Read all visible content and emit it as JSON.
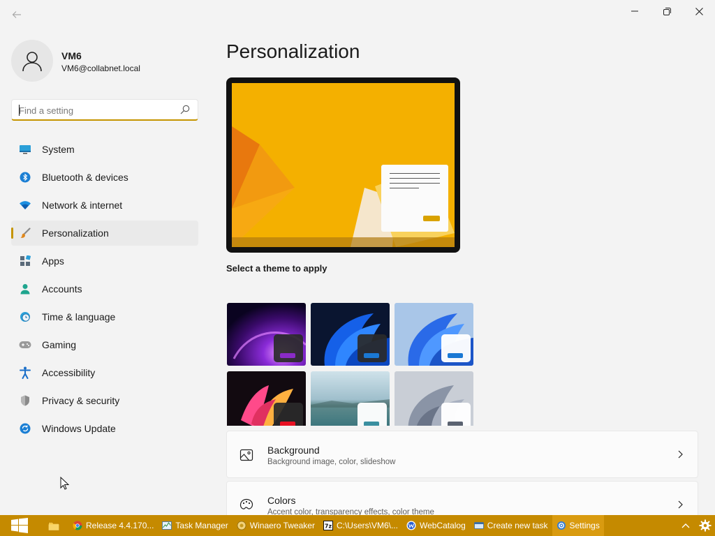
{
  "window": {
    "back_icon": "back-arrow-icon",
    "controls": [
      "minimize-icon",
      "restore-icon",
      "close-icon"
    ]
  },
  "profile": {
    "name": "VM6",
    "email": "VM6@collabnet.local"
  },
  "search": {
    "placeholder": "Find a setting",
    "value": ""
  },
  "nav": {
    "items": [
      {
        "label": "System",
        "icon": "monitor-icon"
      },
      {
        "label": "Bluetooth & devices",
        "icon": "bluetooth-icon"
      },
      {
        "label": "Network & internet",
        "icon": "wifi-icon"
      },
      {
        "label": "Personalization",
        "icon": "brush-icon",
        "active": true
      },
      {
        "label": "Apps",
        "icon": "apps-icon"
      },
      {
        "label": "Accounts",
        "icon": "person-icon"
      },
      {
        "label": "Time & language",
        "icon": "clock-globe-icon"
      },
      {
        "label": "Gaming",
        "icon": "gamepad-icon"
      },
      {
        "label": "Accessibility",
        "icon": "accessibility-icon"
      },
      {
        "label": "Privacy & security",
        "icon": "shield-icon"
      },
      {
        "label": "Windows Update",
        "icon": "update-icon"
      }
    ]
  },
  "main": {
    "title": "Personalization",
    "theme_label": "Select a theme to apply",
    "themes": [
      {
        "name": "dark-purple-glow"
      },
      {
        "name": "windows-dark-bloom"
      },
      {
        "name": "windows-light-bloom"
      },
      {
        "name": "captured-motion"
      },
      {
        "name": "glow-lake"
      },
      {
        "name": "sunrise-flow"
      }
    ],
    "cards": [
      {
        "title": "Background",
        "subtitle": "Background image, color, slideshow",
        "icon": "image-icon"
      },
      {
        "title": "Colors",
        "subtitle": "Accent color, transparency effects, color theme",
        "icon": "palette-icon"
      }
    ]
  },
  "taskbar": {
    "accent": "#c58a00",
    "items": [
      {
        "label": "",
        "icon": "file-explorer-icon"
      },
      {
        "label": "Release 4.4.170...",
        "icon": "chrome-icon"
      },
      {
        "label": "Task Manager",
        "icon": "task-manager-icon"
      },
      {
        "label": "Winaero Tweaker",
        "icon": "winaero-icon"
      },
      {
        "label": "C:\\Users\\VM6\\...",
        "icon": "7zip-icon"
      },
      {
        "label": "WebCatalog",
        "icon": "webcatalog-icon"
      },
      {
        "label": "Create new task",
        "icon": "task-icon"
      },
      {
        "label": "Settings",
        "icon": "settings-icon",
        "active": true
      }
    ],
    "tray": [
      "chevron-up-icon",
      "gear-icon"
    ]
  }
}
